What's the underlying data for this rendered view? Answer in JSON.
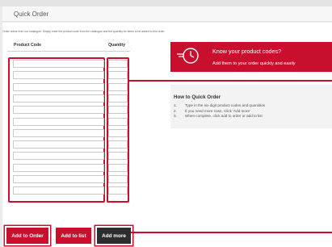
{
  "header": {
    "title": "Quick Order"
  },
  "intro": "Order online from our catalogue. Simply enter the product code from the catalogue and the quantity for items to be added to this order.",
  "table": {
    "code_header": "Product Code",
    "qty_header": "Quantity",
    "rows": 12
  },
  "buttons": {
    "add_to_order": "Add to Order",
    "add_to_list": "Add to list",
    "add_more": "Add more"
  },
  "banner": {
    "title": "Know your product codes?",
    "subtitle": "Add them to your order quickly and easily",
    "icon": "fast-clock-icon"
  },
  "howto": {
    "title": "How to Quick Order",
    "steps": [
      {
        "num": "1.",
        "text": "Type in the six digit product codes and quantities"
      },
      {
        "num": "2.",
        "text": "If you need more rows, Click 'Add more'"
      },
      {
        "num": "3.",
        "text": "When complete, click add to order or add to list"
      }
    ]
  },
  "colors": {
    "accent": "#c8102e",
    "dark_button": "#2d2d2d"
  }
}
